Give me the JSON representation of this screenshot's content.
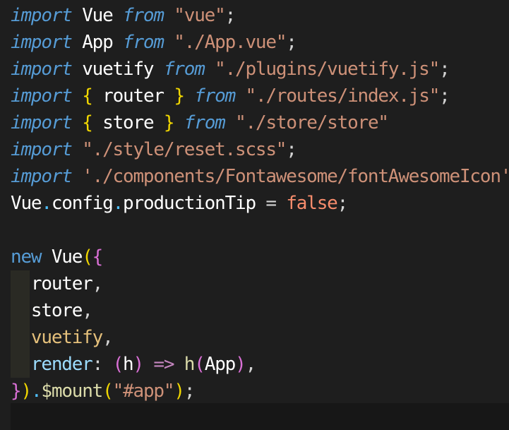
{
  "editor": {
    "lines": [
      {
        "t": [
          [
            "kw",
            "import"
          ],
          [
            "ident",
            " Vue "
          ],
          [
            "kw",
            "from"
          ],
          [
            "str",
            " \"vue\""
          ],
          [
            "punct",
            ";"
          ]
        ]
      },
      {
        "t": [
          [
            "kw",
            "import"
          ],
          [
            "ident",
            " App "
          ],
          [
            "kw",
            "from"
          ],
          [
            "str",
            " \"./App.vue\""
          ],
          [
            "punct",
            ";"
          ]
        ]
      },
      {
        "t": [
          [
            "kw",
            "import"
          ],
          [
            "ident",
            " vuetify "
          ],
          [
            "kw",
            "from"
          ],
          [
            "str",
            " \"./plugins/vuetify.js\""
          ],
          [
            "punct",
            ";"
          ]
        ]
      },
      {
        "t": [
          [
            "kw",
            "import"
          ],
          [
            "ident",
            " "
          ],
          [
            "brace-y",
            "{"
          ],
          [
            "ident",
            " router "
          ],
          [
            "brace-y",
            "}"
          ],
          [
            "ident",
            " "
          ],
          [
            "kw",
            "from"
          ],
          [
            "str",
            " \"./routes/index.js\""
          ],
          [
            "punct",
            ";"
          ]
        ]
      },
      {
        "t": [
          [
            "kw",
            "import"
          ],
          [
            "ident",
            " "
          ],
          [
            "brace-y",
            "{"
          ],
          [
            "ident",
            " store "
          ],
          [
            "brace-y",
            "}"
          ],
          [
            "ident",
            " "
          ],
          [
            "kw",
            "from"
          ],
          [
            "str",
            " \"./store/store\""
          ]
        ]
      },
      {
        "t": [
          [
            "kw",
            "import"
          ],
          [
            "str",
            " \"./style/reset.scss\""
          ],
          [
            "punct",
            ";"
          ]
        ]
      },
      {
        "t": [
          [
            "kw",
            "import"
          ],
          [
            "str",
            " './components/Fontawesome/fontAwesomeIcon'"
          ]
        ]
      },
      {
        "t": [
          [
            "ident",
            "Vue"
          ],
          [
            "dot",
            "."
          ],
          [
            "ident",
            "config"
          ],
          [
            "dot",
            "."
          ],
          [
            "ident",
            "productionTip"
          ],
          [
            "punct",
            " = "
          ],
          [
            "bool",
            "false"
          ],
          [
            "punct",
            ";"
          ]
        ]
      },
      {
        "t": []
      },
      {
        "t": [
          [
            "kw-plain",
            "new"
          ],
          [
            "ident",
            " Vue"
          ],
          [
            "brace-y",
            "("
          ],
          [
            "brace-p",
            "{"
          ]
        ]
      },
      {
        "t": [
          [
            "ident",
            "  router"
          ],
          [
            "punct",
            ","
          ]
        ],
        "guide": true
      },
      {
        "t": [
          [
            "ident",
            "  store"
          ],
          [
            "punct",
            ","
          ]
        ],
        "guide": true
      },
      {
        "t": [
          [
            "yellow",
            "  vuetify"
          ],
          [
            "punct",
            ","
          ]
        ],
        "guide": true
      },
      {
        "t": [
          [
            "prop",
            "  render"
          ],
          [
            "punct",
            ": "
          ],
          [
            "brace-p",
            "("
          ],
          [
            "ident",
            "h"
          ],
          [
            "brace-p",
            ")"
          ],
          [
            "op",
            " =>"
          ],
          [
            "fn",
            " h"
          ],
          [
            "brace-p",
            "("
          ],
          [
            "ident",
            "App"
          ],
          [
            "brace-p",
            ")"
          ],
          [
            "punct",
            ","
          ]
        ],
        "guide": true
      },
      {
        "t": [
          [
            "brace-p",
            "}"
          ],
          [
            "brace-y",
            ")"
          ],
          [
            "dot",
            "."
          ],
          [
            "fn",
            "$mount"
          ],
          [
            "brace-y",
            "("
          ],
          [
            "str",
            "\"#app\""
          ],
          [
            "brace-y",
            ")"
          ],
          [
            "punct",
            ";"
          ]
        ]
      }
    ]
  }
}
